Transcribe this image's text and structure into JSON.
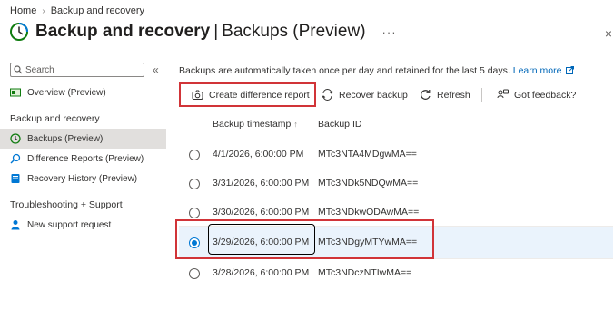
{
  "breadcrumb": {
    "home": "Home",
    "current": "Backup and recovery"
  },
  "header": {
    "title_main": "Backup and recovery",
    "title_sub": "Backups (Preview)",
    "more": "···",
    "close": "×"
  },
  "sidebar": {
    "search_placeholder": "Search",
    "collapse": "«",
    "items": [
      {
        "label": "Overview (Preview)",
        "icon": "overview-icon"
      },
      {
        "label": "Backups (Preview)",
        "icon": "clock-icon",
        "active": true
      },
      {
        "label": "Difference Reports (Preview)",
        "icon": "search-icon"
      },
      {
        "label": "Recovery History (Preview)",
        "icon": "history-icon"
      },
      {
        "label": "New support request",
        "icon": "person-icon"
      }
    ],
    "sections": [
      {
        "title": "Backup and recovery"
      },
      {
        "title": "Troubleshooting + Support"
      }
    ]
  },
  "main": {
    "info_text": "Backups are automatically taken once per day and retained for the last 5 days.",
    "learn_more": "Learn more",
    "toolbar": {
      "create": "Create difference report",
      "recover": "Recover backup",
      "refresh": "Refresh",
      "feedback": "Got feedback?"
    },
    "columns": {
      "timestamp": "Backup timestamp",
      "sort_arrow": "↑",
      "id": "Backup ID"
    },
    "rows": [
      {
        "timestamp": "4/1/2026, 6:00:00 PM",
        "id": "MTc3NTA4MDgwMA==",
        "selected": false
      },
      {
        "timestamp": "3/31/2026, 6:00:00 PM",
        "id": "MTc3NDk5NDQwMA==",
        "selected": false
      },
      {
        "timestamp": "3/30/2026, 6:00:00 PM",
        "id": "MTc3NDkwODAwMA==",
        "selected": false
      },
      {
        "timestamp": "3/29/2026, 6:00:00 PM",
        "id": "MTc3NDgyMTYwMA==",
        "selected": true
      },
      {
        "timestamp": "3/28/2026, 6:00:00 PM",
        "id": "MTc3NDczNTIwMA==",
        "selected": false
      }
    ]
  },
  "colors": {
    "accent": "#0078d4",
    "highlight": "#d13438",
    "link": "#0067b8"
  }
}
